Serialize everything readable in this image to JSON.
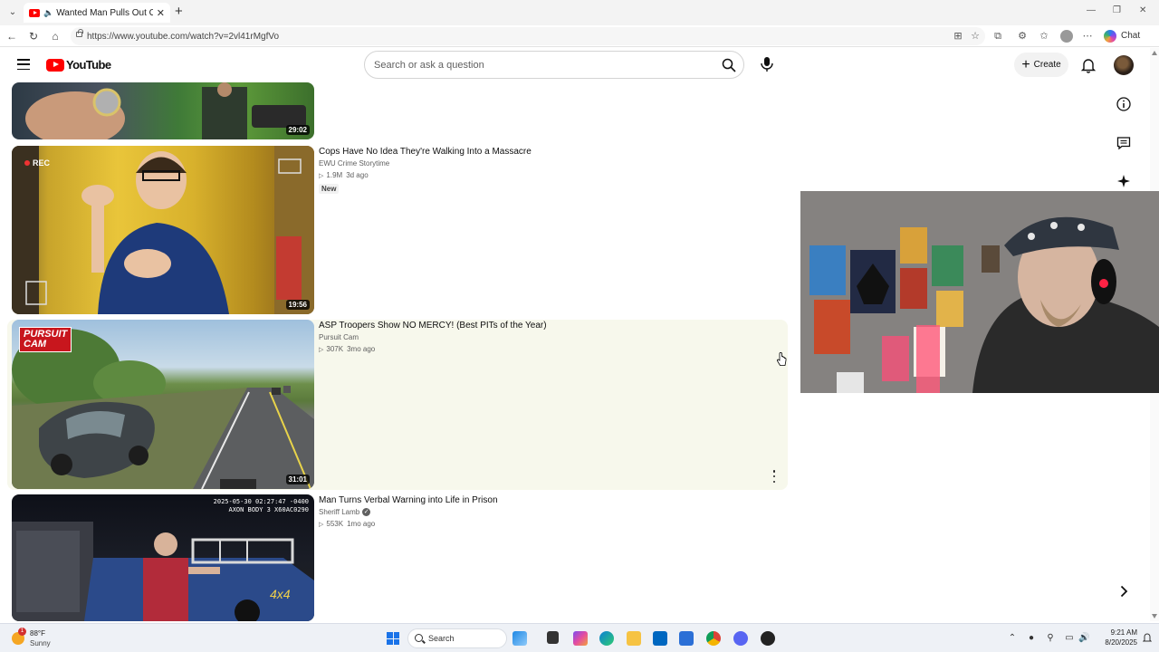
{
  "browser": {
    "tab_title": "Wanted Man Pulls Out Chains",
    "url": "https://www.youtube.com/watch?v=2vl41rMgfVo",
    "chat_label": "Chat"
  },
  "yt_header": {
    "logo_text": "YouTube",
    "search_placeholder": "Search or ask a question",
    "create_label": "Create"
  },
  "videos": [
    {
      "title": "",
      "channel": "",
      "duration": "29:02"
    },
    {
      "title": "Cops Have No Idea They're Walking Into a Massacre",
      "channel": "EWU Crime Storytime",
      "views": "1.9M",
      "age": "3d ago",
      "badge": "New",
      "duration": "19:56",
      "overlay_text": "REC"
    },
    {
      "title": "ASP Troopers Show NO MERCY! (Best PITs of the Year)",
      "channel": "Pursuit Cam",
      "views": "307K",
      "age": "3mo ago",
      "duration": "31:01",
      "overlay_text": "PURSUIT\nCAM"
    },
    {
      "title": "Man Turns Verbal Warning into Life in Prison",
      "channel": "Sheriff Lamb",
      "views": "553K",
      "age": "1mo ago",
      "verified": true,
      "overlay_line1": "2025-05-30  02:27:47 -0400",
      "overlay_line2": "AXON BODY 3  X60AC0290"
    }
  ],
  "taskbar": {
    "weather_temp": "88°F",
    "weather_condition": "Sunny",
    "weather_badge": "1",
    "search_label": "Search",
    "time": "9:21 AM",
    "date": "8/20/2025"
  },
  "colors": {
    "youtube_red": "#ff0000",
    "hover_row": "#f7f8ec",
    "windows_blue": "#1a73e8"
  }
}
